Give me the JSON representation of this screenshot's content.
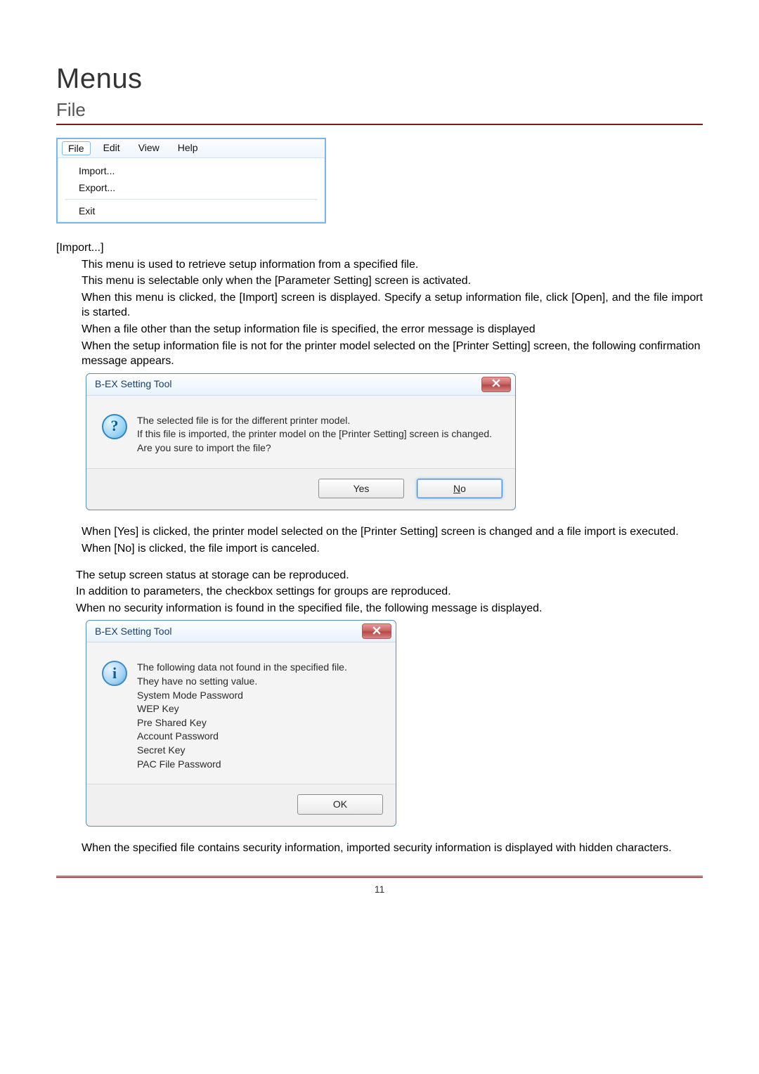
{
  "headings": {
    "main": "Menus",
    "section": "File"
  },
  "menubar": {
    "top": {
      "file": "File",
      "edit": "Edit",
      "view": "View",
      "help": "Help"
    },
    "items": {
      "import": "Import...",
      "export": "Export...",
      "exit": "Exit"
    }
  },
  "labels": {
    "import_heading": "[Import...]"
  },
  "import_text": {
    "p1": "This menu is used to retrieve setup information from a specified file.",
    "p2": "This menu is selectable only when the [Parameter Setting] screen is activated.",
    "p3": "When this menu is clicked, the [Import] screen is displayed. Specify a setup information file, click [Open], and the file import is started.",
    "p4": "When a file other than the setup information file is specified, the error message is displayed",
    "p5": "When the setup information file is not for the printer model selected on the [Printer Setting] screen, the following confirmation message appears."
  },
  "dialog1": {
    "title": "B-EX Setting Tool",
    "line1": "The selected file is for the different printer model.",
    "line2": "If this file is imported, the printer model on the [Printer Setting] screen is changed.",
    "line3": "Are you sure to import the file?",
    "yes": "Yes",
    "no_pre": "N",
    "no_post": "o"
  },
  "after1": {
    "p1": "When [Yes] is clicked, the printer model selected on the [Printer Setting] screen is changed and a file import is executed.",
    "p2": "When [No] is clicked, the file import is canceled."
  },
  "mid_text": {
    "p1": "The setup screen status at storage can be reproduced.",
    "p2": "In addition to parameters, the checkbox settings for groups are reproduced.",
    "p3": "When no security information is found in the specified file, the following message is displayed."
  },
  "dialog2": {
    "title": "B-EX Setting Tool",
    "l1": "The following data not found in the specified file.",
    "l2": "They have no setting value.",
    "l3": "System Mode Password",
    "l4": "WEP Key",
    "l5": "Pre Shared Key",
    "l6": "Account Password",
    "l7": "Secret Key",
    "l8": "PAC File Password",
    "ok": "OK"
  },
  "after2": {
    "p1": "When the specified file contains security information, imported security information is displayed with hidden characters."
  },
  "footer": {
    "page": "11"
  }
}
